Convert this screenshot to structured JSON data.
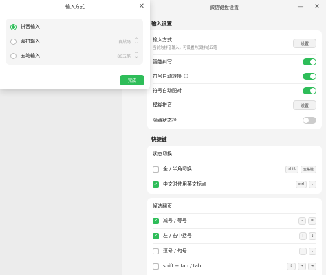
{
  "settings": {
    "window_title": "微信键盘设置",
    "input_section": {
      "title": "输入设置",
      "input_method_label": "输入方式",
      "input_method_desc": "当前为拼音输入，可设置为双拼或五笔",
      "input_method_btn": "设置",
      "smart_correct_label": "智能纠写",
      "symbol_convert_label": "符号自动转换",
      "symbol_pair_label": "符号自动配对",
      "fuzzy_pinyin_label": "模糊拼音",
      "fuzzy_pinyin_btn": "设置",
      "hide_status_label": "隐藏状态栏"
    },
    "shortcut_section": {
      "title": "快捷键",
      "status_switch_title": "状态切换",
      "full_half_label": "全 / 半角切换",
      "full_half_keys": [
        "shift",
        "空格键"
      ],
      "cn_en_punct_label": "中文时使用英文标点",
      "cn_en_punct_keys": [
        "ctrl",
        "."
      ],
      "candidate_title": "候选翻页",
      "minus_equal_label": "减号 / 等号",
      "minus_equal_keys": [
        "-",
        "="
      ],
      "brackets_label": "左 / 右中括号",
      "brackets_keys": [
        "[",
        "]"
      ],
      "comma_period_label": "逗号 / 句号",
      "comma_period_keys": [
        ",",
        "."
      ],
      "shift_tab_label": "shift + tab / tab",
      "shift_tab_keys": [
        "⇧",
        "⇥",
        "⇥"
      ]
    }
  },
  "dialog": {
    "title": "输入方式",
    "options": [
      {
        "label": "拼音输入",
        "value": "",
        "selected": true
      },
      {
        "label": "双拼输入",
        "value": "自然码",
        "selected": false
      },
      {
        "label": "五笔输入",
        "value": "86五笔",
        "selected": false
      }
    ],
    "done_label": "完成"
  },
  "colors": {
    "accent": "#2ebd59"
  }
}
